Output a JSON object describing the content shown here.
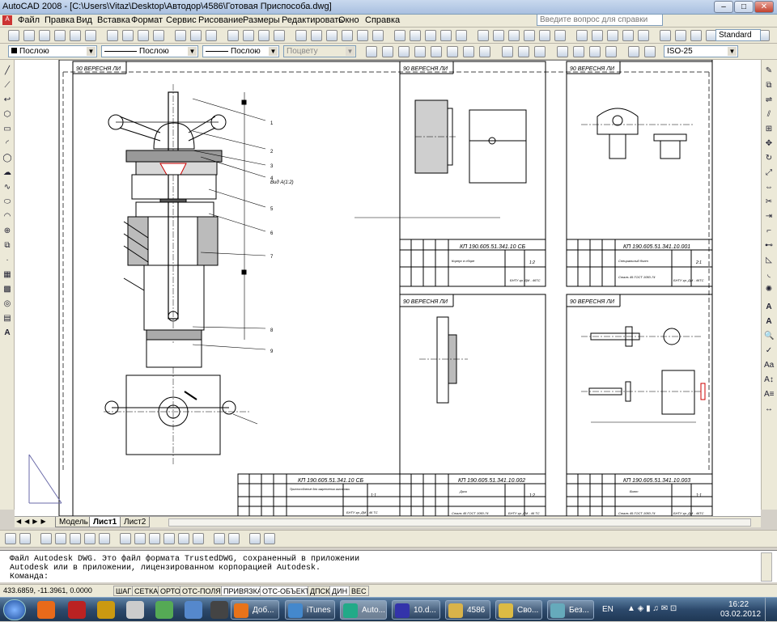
{
  "window": {
    "title": "AutoCAD 2008 - [C:\\Users\\Vitaz\\Desktop\\Автодор\\4586\\Готовая Приспособа.dwg]",
    "help_placeholder": "Введите вопрос для справки"
  },
  "menu": [
    "Файл",
    "Правка",
    "Вид",
    "Вставка",
    "Формат",
    "Сервис",
    "Рисование",
    "Размеры",
    "Редактировать",
    "Окно",
    "Справка"
  ],
  "properties_bar": {
    "layer": "Послою",
    "color": "Послою",
    "linetype": "Послою",
    "lineweight": "Послою",
    "plotstyle": "Поцвету",
    "dimstyle": "ISO-25",
    "textstyle": "Standard"
  },
  "layout_tabs": [
    "Модель",
    "Лист1",
    "Лист2"
  ],
  "command_lines": [
    "Файл Autodesk DWG. Это файл формата TrustedDWG, сохраненный в приложении",
    "Autodesk или в приложении, лицензированном корпорацией Autodesk.",
    "Команда:"
  ],
  "status": {
    "coords": "433.6859, -11.3961, 0.0000",
    "toggles": [
      "ШАГ",
      "СЕТКА",
      "ОРТО",
      "ОТС-ПОЛЯР",
      "ПРИВЯЗКА",
      "ОТС-ОБЪЕКТ",
      "ДПСК",
      "ДИН",
      "ВЕС"
    ]
  },
  "taskbar": {
    "buttons": [
      "Доб...",
      "iTunes",
      "Auto...",
      "10.d...",
      "4586",
      "Сво...",
      "Без..."
    ],
    "lang": "EN",
    "time": "16:22",
    "date": "03.02.2012"
  },
  "drawing": {
    "stamp_header": "90 ВЕРЕСНЯ ЛИ",
    "main_code": "КП 190.605.51.341.10 СБ",
    "main_title": "Приспособление для закрепления заготовки",
    "main_scale": "1:1",
    "main_org": "БНТУ гр. ДМ - 46 ТС",
    "sheet_b_code": "КП 190.605.51.341.10 СБ",
    "sheet_b_title": "Корпус в сборе",
    "sheet_b_scale": "1:2",
    "sheet_b_org": "БНТУ гр. ДМ - 46ТС",
    "sheet_c_code": "КП 190.605.51.341.10.001",
    "sheet_c_title": "Специальный болт",
    "sheet_c_scale": "2:1",
    "sheet_c_material": "Сталь 45 ГОСТ 1050-74",
    "sheet_c_org": "БНТУ гр. ДМ - 46ТС",
    "sheet_d_code": "КП 190.605.51.341.10.002",
    "sheet_d_title": "Диск",
    "sheet_d_scale": "1:2",
    "sheet_d_material": "Сталь 45 ГОСТ 1050-74",
    "sheet_d_org": "БНТУ гр. ДМ - 46 ТС",
    "sheet_e_code": "КП 190.605.51.341.10.003",
    "sheet_e_title": "Винт",
    "sheet_e_scale": "1:1",
    "sheet_e_material": "Сталь 45 ГОСТ 1050-74",
    "sheet_e_org": "БНТУ гр. ДМ - 46ТС",
    "callouts": [
      "1",
      "2",
      "3",
      "4",
      "5",
      "6",
      "7",
      "8",
      "9"
    ],
    "section_label": "Вид A(1:2)"
  }
}
